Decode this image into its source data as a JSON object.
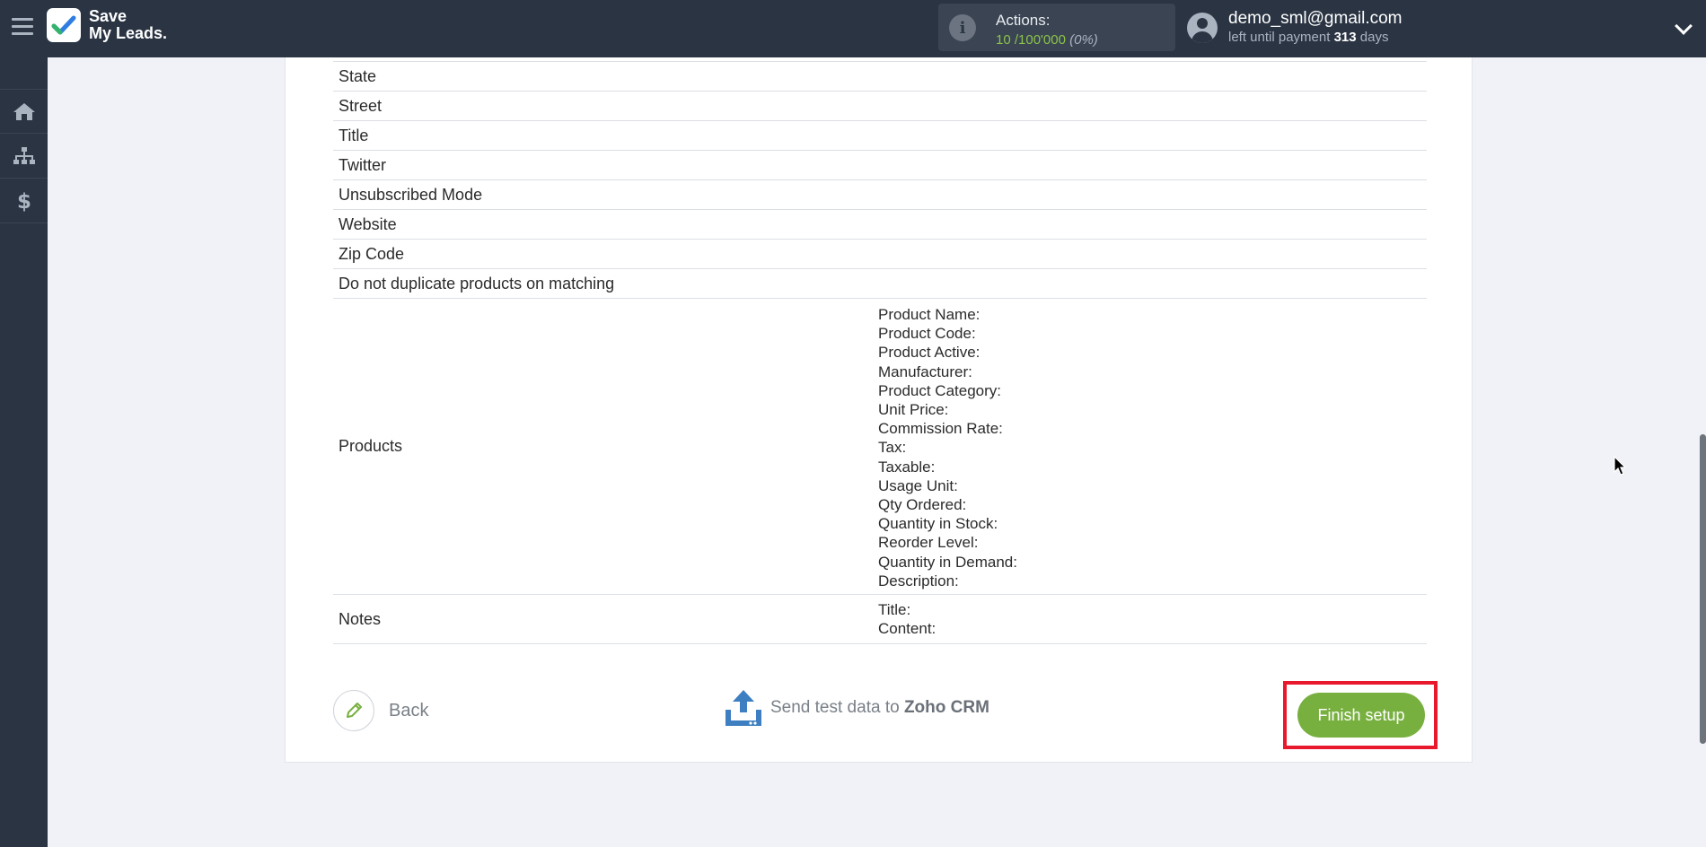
{
  "app": {
    "logo_line1": "Save",
    "logo_line2": "My Leads."
  },
  "header": {
    "actions_label": "Actions:",
    "actions_used": "10",
    "actions_sep": " /",
    "actions_total": "100'000",
    "actions_pct": "(0%)",
    "user_email": "demo_sml@gmail.com",
    "payment_prefix": "left until payment ",
    "payment_days": "313",
    "payment_suffix": " days"
  },
  "sidebar": {
    "items": [
      {
        "icon": "home-icon"
      },
      {
        "icon": "sitemap-icon"
      },
      {
        "icon": "dollar-icon"
      }
    ]
  },
  "fields": {
    "rows": [
      "State",
      "Street",
      "Title",
      "Twitter",
      "Unsubscribed Mode",
      "Website",
      "Zip Code",
      "Do not duplicate products on matching"
    ],
    "products": {
      "label": "Products",
      "values": [
        "Product Name:",
        "Product Code:",
        "Product Active:",
        "Manufacturer:",
        "Product Category:",
        "Unit Price:",
        "Commission Rate:",
        "Tax:",
        "Taxable:",
        "Usage Unit:",
        "Qty Ordered:",
        "Quantity in Stock:",
        "Reorder Level:",
        "Quantity in Demand:",
        "Description:"
      ]
    },
    "notes": {
      "label": "Notes",
      "values": [
        "Title:",
        "Content:"
      ]
    }
  },
  "footer": {
    "back_label": "Back",
    "send_prefix": "Send test data to ",
    "send_target": "Zoho CRM",
    "finish_label": "Finish setup"
  },
  "colors": {
    "topbar": "#2a3443",
    "accent_green": "#78b03f",
    "highlight_red": "#e8192c"
  }
}
